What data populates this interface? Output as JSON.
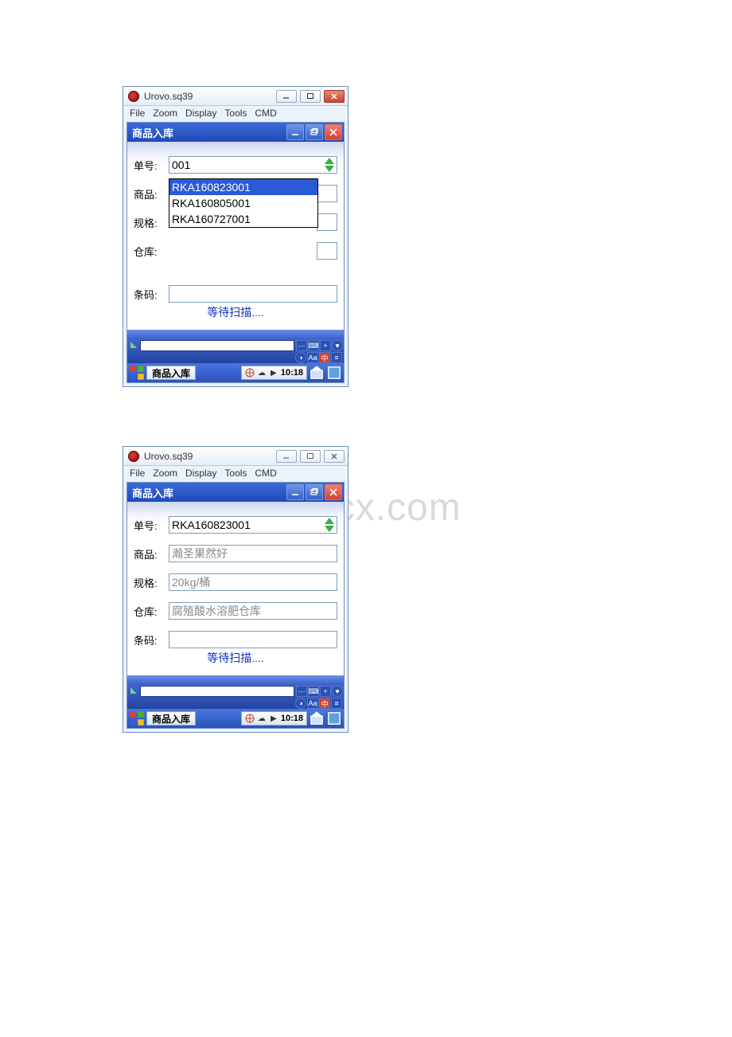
{
  "watermark": "www.bdocx.com",
  "app": {
    "title": "Urovo.sq39",
    "menu": {
      "file": "File",
      "zoom": "Zoom",
      "display": "Display",
      "tools": "Tools",
      "cmd": "CMD"
    }
  },
  "inner": {
    "title": "商品入库",
    "labels": {
      "order_no": "单号:",
      "product": "商品:",
      "spec": "规格:",
      "warehouse": "仓库:",
      "barcode": "条码:"
    },
    "status": "等待扫描...."
  },
  "screen1": {
    "order_no_value": "001",
    "dropdown": {
      "selected": "RKA160823001",
      "options": [
        "RKA160823001",
        "RKA160805001",
        "RKA160727001"
      ]
    }
  },
  "screen2": {
    "order_no_value": "RKA160823001",
    "product_value": "瀚圣果然好",
    "spec_value": "20kg/桶",
    "warehouse_value": "腐殖酸水溶肥仓库",
    "barcode_value": ""
  },
  "taskbar": {
    "app_label": "商品入库",
    "clock": "10:18"
  },
  "ime": {
    "aa": "Aa",
    "zh": "中"
  }
}
